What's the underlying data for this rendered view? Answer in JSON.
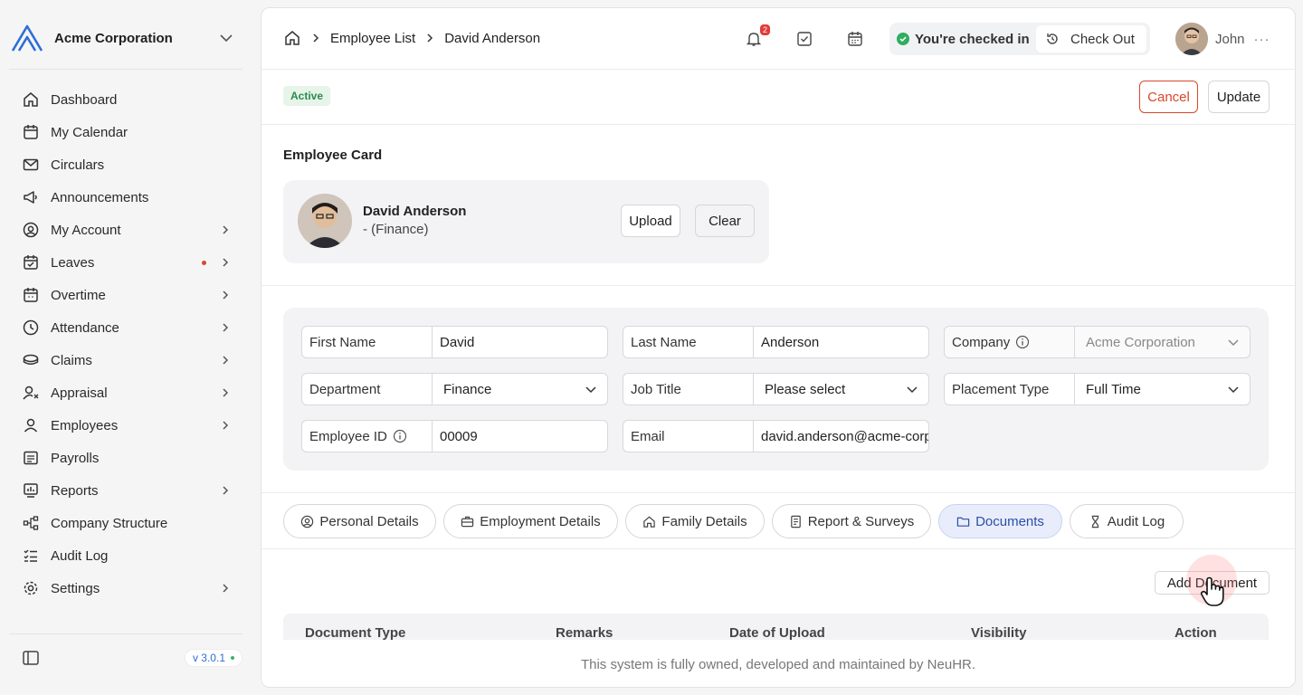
{
  "brand": {
    "name": "Acme Corporation"
  },
  "sidebar": {
    "items": [
      {
        "label": "Dashboard",
        "icon": "home-icon",
        "arrow": false,
        "dot": false
      },
      {
        "label": "My Calendar",
        "icon": "calendar-icon",
        "arrow": false,
        "dot": false
      },
      {
        "label": "Circulars",
        "icon": "mail-icon",
        "arrow": false,
        "dot": false
      },
      {
        "label": "Announcements",
        "icon": "megaphone-icon",
        "arrow": false,
        "dot": false
      },
      {
        "label": "My Account",
        "icon": "user-circle-icon",
        "arrow": true,
        "dot": false
      },
      {
        "label": "Leaves",
        "icon": "calendar-check-icon",
        "arrow": true,
        "dot": true
      },
      {
        "label": "Overtime",
        "icon": "calendar-clock-icon",
        "arrow": true,
        "dot": false
      },
      {
        "label": "Attendance",
        "icon": "clock-icon",
        "arrow": true,
        "dot": false
      },
      {
        "label": "Claims",
        "icon": "coins-icon",
        "arrow": true,
        "dot": false
      },
      {
        "label": "Appraisal",
        "icon": "user-star-icon",
        "arrow": true,
        "dot": false
      },
      {
        "label": "Employees",
        "icon": "user-icon",
        "arrow": true,
        "dot": false
      },
      {
        "label": "Payrolls",
        "icon": "payroll-icon",
        "arrow": false,
        "dot": false
      },
      {
        "label": "Reports",
        "icon": "report-icon",
        "arrow": true,
        "dot": false
      },
      {
        "label": "Company Structure",
        "icon": "hierarchy-icon",
        "arrow": false,
        "dot": false
      },
      {
        "label": "Audit Log",
        "icon": "checklist-icon",
        "arrow": false,
        "dot": false
      },
      {
        "label": "Settings",
        "icon": "gear-icon",
        "arrow": true,
        "dot": false
      }
    ],
    "version": "v 3.0.1"
  },
  "breadcrumb": {
    "level1": "Employee List",
    "level2": "David Anderson"
  },
  "topbar": {
    "notification_count": "2",
    "checkin_text": "You're checked in",
    "checkout_label": "Check Out",
    "user_name": "John",
    "more": "···"
  },
  "status": {
    "label": "Active"
  },
  "actions": {
    "cancel": "Cancel",
    "update": "Update"
  },
  "employee_card": {
    "title": "Employee Card",
    "name": "David Anderson",
    "dept": "- (Finance)",
    "upload": "Upload",
    "clear": "Clear"
  },
  "form": {
    "first_name_label": "First Name",
    "first_name": "David",
    "last_name_label": "Last Name",
    "last_name": "Anderson",
    "company_label": "Company",
    "company": "Acme Corporation",
    "department_label": "Department",
    "department": "Finance",
    "job_title_label": "Job Title",
    "job_title": "Please select",
    "placement_label": "Placement Type",
    "placement": "Full Time",
    "employee_id_label": "Employee ID",
    "employee_id": "00009",
    "email_label": "Email",
    "email": "david.anderson@acme-corporation.com"
  },
  "tabs": [
    {
      "label": "Personal Details",
      "icon": "user-circle-icon"
    },
    {
      "label": "Employment Details",
      "icon": "briefcase-icon"
    },
    {
      "label": "Family Details",
      "icon": "home-icon"
    },
    {
      "label": "Report & Surveys",
      "icon": "document-icon"
    },
    {
      "label": "Documents",
      "icon": "folder-icon"
    },
    {
      "label": "Audit Log",
      "icon": "hourglass-icon"
    }
  ],
  "documents": {
    "add_label": "Add Document",
    "columns": [
      "Document Type",
      "Remarks",
      "Date of Upload",
      "Visibility",
      "Action"
    ]
  },
  "footer": {
    "text": "This system is fully owned, developed and maintained by NeuHR."
  },
  "colors": {
    "accent": "#2b4fa8",
    "danger": "#d9472b",
    "success": "#2eae5f"
  }
}
